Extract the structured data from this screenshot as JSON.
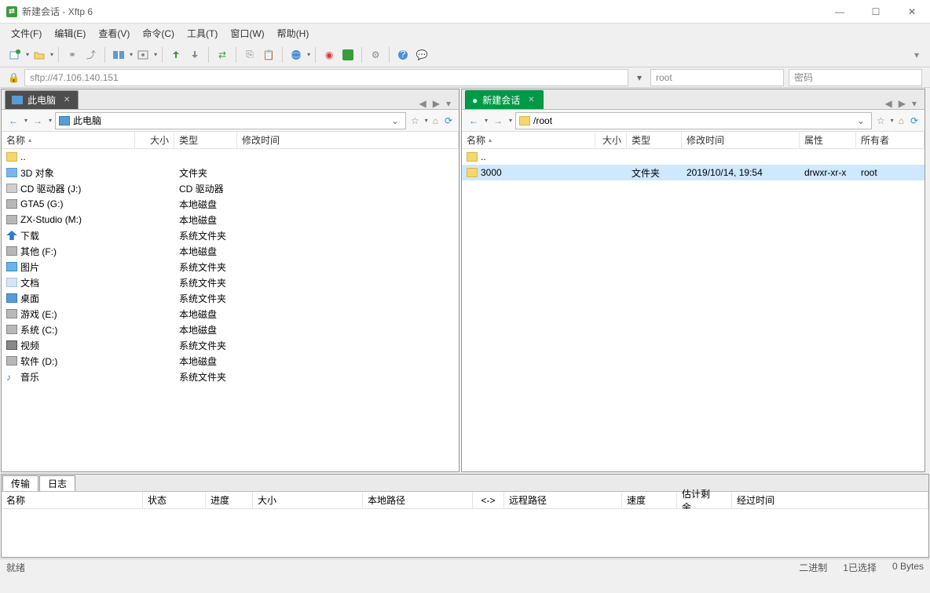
{
  "title": "新建会话 - Xftp 6",
  "menu": [
    "文件(F)",
    "编辑(E)",
    "查看(V)",
    "命令(C)",
    "工具(T)",
    "窗口(W)",
    "帮助(H)"
  ],
  "address": "sftp://47.106.140.151",
  "user": "root",
  "password_placeholder": "密码",
  "left": {
    "tab_label": "此电脑",
    "path": "此电脑",
    "cols": {
      "name": "名称",
      "size": "大小",
      "type": "类型",
      "mtime": "修改时间"
    },
    "rows": [
      {
        "icon": "folder-up",
        "name": "..",
        "type": ""
      },
      {
        "icon": "cube",
        "name": "3D 对象",
        "type": "文件夹"
      },
      {
        "icon": "disk",
        "name": "CD 驱动器 (J:)",
        "type": "CD 驱动器"
      },
      {
        "icon": "drive",
        "name": "GTA5 (G:)",
        "type": "本地磁盘"
      },
      {
        "icon": "drive",
        "name": "ZX-Studio (M:)",
        "type": "本地磁盘"
      },
      {
        "icon": "arrow",
        "name": "下载",
        "type": "系统文件夹"
      },
      {
        "icon": "drive",
        "name": "其他 (F:)",
        "type": "本地磁盘"
      },
      {
        "icon": "pic",
        "name": "图片",
        "type": "系统文件夹"
      },
      {
        "icon": "doc",
        "name": "文档",
        "type": "系统文件夹"
      },
      {
        "icon": "monitor",
        "name": "桌面",
        "type": "系统文件夹"
      },
      {
        "icon": "drive",
        "name": "游戏 (E:)",
        "type": "本地磁盘"
      },
      {
        "icon": "drive",
        "name": "系统 (C:)",
        "type": "本地磁盘"
      },
      {
        "icon": "film",
        "name": "视频",
        "type": "系统文件夹"
      },
      {
        "icon": "drive",
        "name": "软件 (D:)",
        "type": "本地磁盘"
      },
      {
        "icon": "music",
        "name": "音乐",
        "type": "系统文件夹"
      }
    ]
  },
  "right": {
    "tab_label": "新建会话",
    "path": "/root",
    "cols": {
      "name": "名称",
      "size": "大小",
      "type": "类型",
      "mtime": "修改时间",
      "attrs": "属性",
      "owner": "所有者"
    },
    "rows": [
      {
        "icon": "folder-up",
        "name": "..",
        "type": "",
        "mtime": "",
        "attrs": "",
        "owner": ""
      },
      {
        "icon": "folder",
        "name": "3000",
        "type": "文件夹",
        "mtime": "2019/10/14, 19:54",
        "attrs": "drwxr-xr-x",
        "owner": "root",
        "sel": true
      }
    ]
  },
  "transfer": {
    "tabs": [
      "传输",
      "日志"
    ],
    "cols": [
      "名称",
      "状态",
      "进度",
      "大小",
      "本地路径",
      "<->",
      "远程路径",
      "速度",
      "估计剩余…",
      "经过时间"
    ]
  },
  "status": {
    "ready": "就绪",
    "binary": "二进制",
    "sel": "1已选择",
    "bytes": "0 Bytes"
  }
}
